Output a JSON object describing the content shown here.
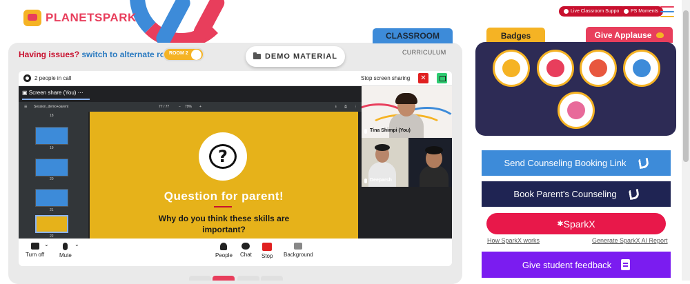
{
  "header": {
    "logo_text": "PLANETSPARK",
    "live_support_label": "Live Classroom Support",
    "ps_moments_label": "PS Moments",
    "brand_colors": {
      "red": "#c8102e",
      "pink": "#e83e5c",
      "blue": "#3d8bd9",
      "yellow": "#f5b324",
      "navy": "#1f2453",
      "purple": "#7b1cf0"
    }
  },
  "classroom": {
    "issues_text": "Having issues?",
    "alternate_link": "switch to alternate room",
    "room_toggle_label": "ROOM 2",
    "demo_material_label": "DEMO MATERIAL",
    "tab_classroom": "CLASSROOM",
    "tab_curriculum": "CURRICULUM"
  },
  "meet": {
    "people_count": "2 people in call",
    "stop_sharing_label": "Stop screen sharing",
    "share_title": "Screen share (You)",
    "more_icon": "⋯",
    "pdf_filename": "Session_demo+parent",
    "pdf_page": "77 / 77",
    "pdf_zoom": "79%",
    "thumb_numbers": [
      "18",
      "19",
      "20",
      "21",
      "22"
    ],
    "slide_title": "Question for parent!",
    "slide_question": "Why do you think these skills are important?",
    "participants": [
      {
        "name": "Tina Shimpi (You)"
      },
      {
        "name": "Deeparsh"
      }
    ],
    "controls": [
      {
        "label": "Turn off",
        "icon": "camera-icon"
      },
      {
        "label": "Mute",
        "icon": "microphone-icon"
      },
      {
        "label": "People",
        "icon": "people-icon"
      },
      {
        "label": "Chat",
        "icon": "chat-icon"
      },
      {
        "label": "Stop",
        "icon": "stop-share-icon"
      },
      {
        "label": "Background",
        "icon": "background-icon"
      }
    ]
  },
  "right_panel": {
    "badges_tab": "Badges",
    "applause_tab": "Give Applause",
    "badges": [
      "trophy-badge-icon",
      "fist-badge-icon",
      "star-person-badge-icon",
      "idea-badge-icon",
      "brain-badge-icon"
    ],
    "send_counseling_link": "Send Counseling Booking Link",
    "book_parent_counseling": "Book Parent's Counseling",
    "sparkx_label": "SparkX",
    "how_sparkx_works": "How SparkX works",
    "generate_report": "Generate SparkX AI Report",
    "give_feedback": "Give student feedback"
  }
}
